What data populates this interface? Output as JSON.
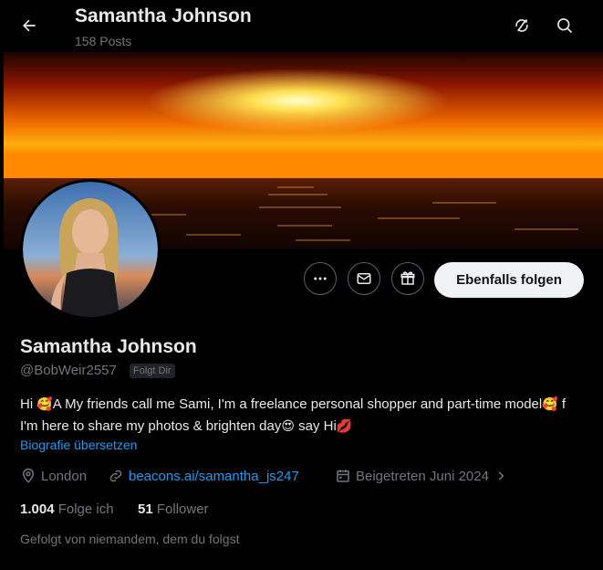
{
  "header": {
    "title": "Samantha Johnson",
    "posts_count": "158 Posts"
  },
  "profile": {
    "name": "Samantha Johnson",
    "handle": "@BobWeir2557",
    "follows_you_badge": "Folgt Dir",
    "bio_part1": "Hi ",
    "bio_emoji1": "🥰",
    "bio_part2": "A My friends call me Sami, I'm a freelance personal shopper and part-time model",
    "bio_emoji2": "🥰",
    "bio_part3": " f I'm here to share my photos &  brighten day",
    "bio_emoji3": "😍",
    "bio_part4": " say Hi",
    "bio_emoji4": "💋",
    "translate_bio": "Biografie übersetzen",
    "location": "London",
    "website": "beacons.ai/samantha_js247",
    "joined": "Beigetreten Juni 2024",
    "following_count": "1.004",
    "following_label": "Folge ich",
    "followers_count": "51",
    "followers_label": "Follower",
    "followed_by": "Gefolgt von niemandem, dem du folgst"
  },
  "actions": {
    "follow_back_label": "Ebenfalls folgen"
  },
  "icons": [
    "back-arrow-icon",
    "refresh-icon",
    "search-icon",
    "more-icon",
    "message-icon",
    "gift-icon",
    "location-icon",
    "link-icon",
    "calendar-icon",
    "chevron-right-icon"
  ],
  "colors": {
    "accent": "#1d9bf0",
    "text": "#e7e9ea",
    "muted": "#71767b",
    "background": "#000000"
  }
}
